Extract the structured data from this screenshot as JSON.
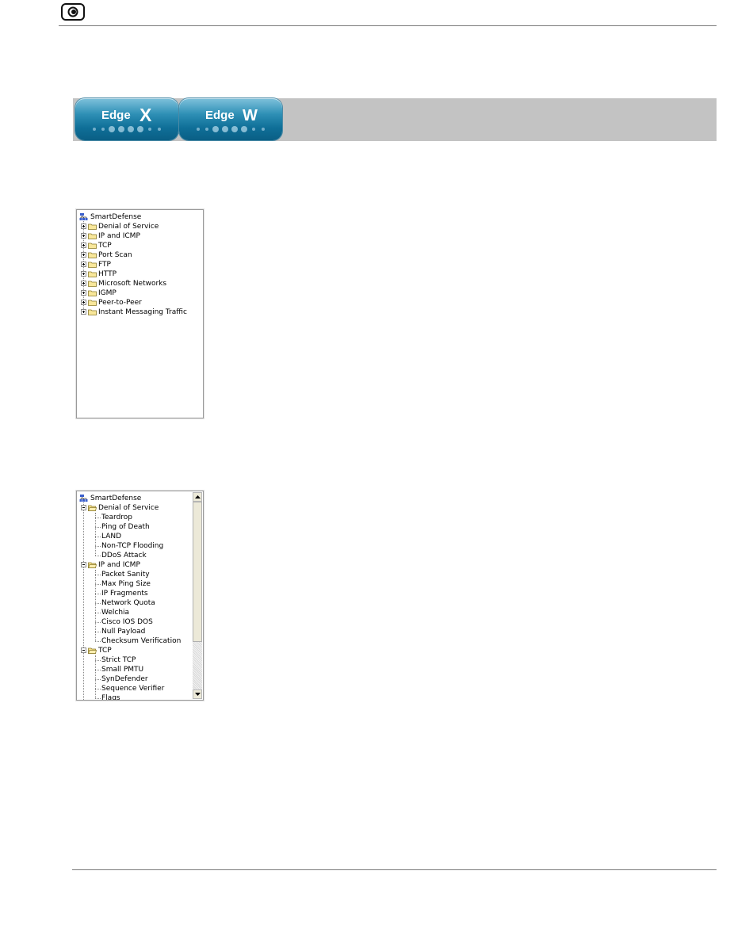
{
  "header": {
    "logo_icon": "circle-dot-logo-icon"
  },
  "edge_banner": {
    "tabs": [
      {
        "word": "Edge",
        "letter": "X"
      },
      {
        "word": "Edge",
        "letter": "W"
      }
    ]
  },
  "tree_collapsed": {
    "root": "SmartDefense",
    "items": [
      "Denial of Service",
      "IP and ICMP",
      "TCP",
      "Port Scan",
      "FTP",
      "HTTP",
      "Microsoft Networks",
      "IGMP",
      "Peer-to-Peer",
      "Instant Messaging Traffic"
    ]
  },
  "tree_expanded": {
    "root": "SmartDefense",
    "groups": [
      {
        "label": "Denial of Service",
        "children": [
          "Teardrop",
          "Ping of Death",
          "LAND",
          "Non-TCP Flooding",
          "DDoS Attack"
        ]
      },
      {
        "label": "IP and ICMP",
        "children": [
          "Packet Sanity",
          "Max Ping Size",
          "IP Fragments",
          "Network Quota",
          "Welchia",
          "Cisco IOS DOS",
          "Null Payload",
          "Checksum Verification"
        ]
      },
      {
        "label": "TCP",
        "children": [
          "Strict TCP",
          "Small PMTU",
          "SynDefender",
          "Sequence Verifier",
          "Flags"
        ]
      }
    ]
  }
}
